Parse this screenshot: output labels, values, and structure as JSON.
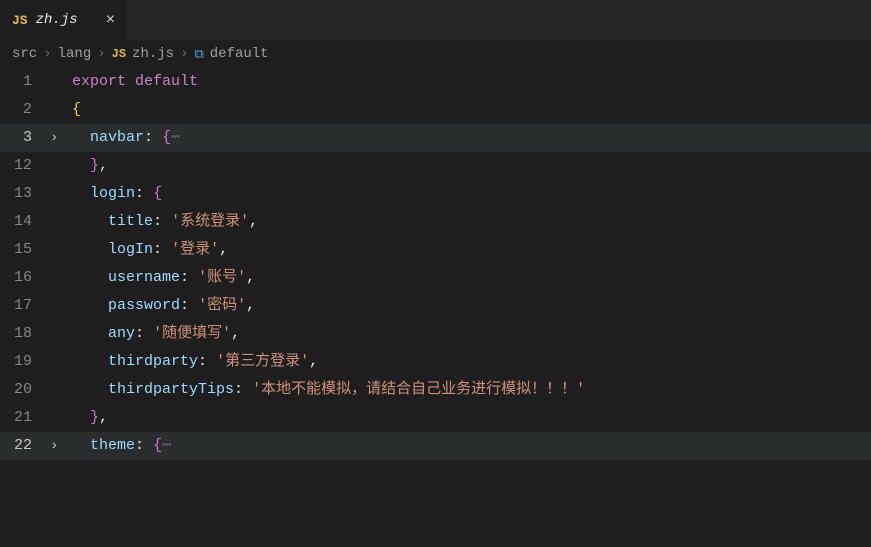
{
  "tab": {
    "icon_text": "JS",
    "title": "zh.js",
    "close_glyph": "×"
  },
  "breadcrumbs": {
    "seg1": "src",
    "seg2": "lang",
    "icon_text": "JS",
    "seg3": "zh.js",
    "sym_glyph": "⧉",
    "seg4": "default",
    "sep": "›"
  },
  "lines": {
    "l1_num": "1",
    "l2_num": "2",
    "l3_num": "3",
    "l12_num": "12",
    "l13_num": "13",
    "l14_num": "14",
    "l15_num": "15",
    "l16_num": "16",
    "l17_num": "17",
    "l18_num": "18",
    "l19_num": "19",
    "l20_num": "20",
    "l21_num": "21",
    "l22_num": "22"
  },
  "fold": {
    "chevron": "›",
    "ellipsis": "⋯"
  },
  "code": {
    "export": "export",
    "default": "default",
    "open_brace": "{",
    "close_brace": "}",
    "comma": ",",
    "colon": ":",
    "navbar": "navbar",
    "login": "login",
    "theme": "theme",
    "title": "title",
    "logIn": "logIn",
    "username": "username",
    "password": "password",
    "any": "any",
    "thirdparty": "thirdparty",
    "thirdpartyTips": "thirdpartyTips",
    "str_title": "'系统登录'",
    "str_logIn": "'登录'",
    "str_username": "'账号'",
    "str_password": "'密码'",
    "str_any": "'随便填写'",
    "str_thirdparty": "'第三方登录'",
    "str_thirdpartyTips": "'本地不能模拟，请结合自己业务进行模拟！！！'"
  }
}
